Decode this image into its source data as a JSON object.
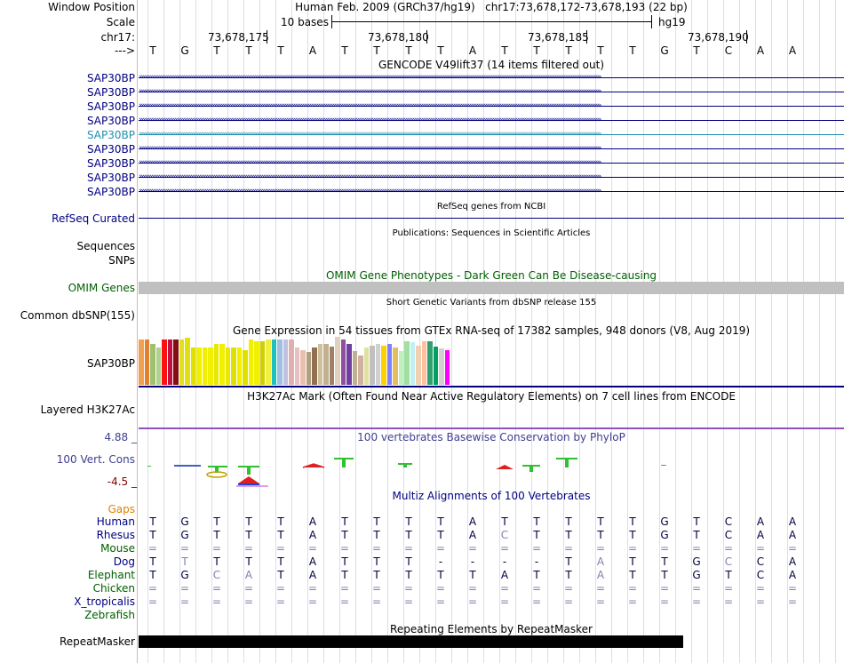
{
  "header": {
    "window_position_label": "Window Position",
    "scale_label": "Scale",
    "chrom_label": "chr17:",
    "strand_label": "--->",
    "window_position_value": "Human Feb. 2009 (GRCh37/hg19)   chr17:73,678,172-73,678,193 (22 bp)",
    "scale_bases": "10 bases",
    "scale_assembly": "hg19",
    "ticks": [
      "73,678,175",
      "73,678,180",
      "73,678,185",
      "73,678,190"
    ]
  },
  "sequence": [
    "T",
    "G",
    "T",
    "T",
    "T",
    "A",
    "T",
    "T",
    "T",
    "T",
    "A",
    "T",
    "T",
    "T",
    "T",
    "T",
    "G",
    "T",
    "C",
    "A",
    "A"
  ],
  "gencode": {
    "title": "GENCODE V49lift37 (14 items filtered out)",
    "items": [
      "SAP30BP",
      "SAP30BP",
      "SAP30BP",
      "SAP30BP",
      "SAP30BP",
      "SAP30BP",
      "SAP30BP",
      "SAP30BP",
      "SAP30BP"
    ]
  },
  "refseq": {
    "title": "RefSeq genes from NCBI",
    "label": "RefSeq Curated"
  },
  "publications": {
    "title": "Publications: Sequences in Scientific Articles",
    "label1": "Sequences",
    "label2": "SNPs"
  },
  "omim": {
    "title": "OMIM Gene Phenotypes - Dark Green Can Be Disease-causing",
    "label": "OMIM Genes"
  },
  "dbsnp": {
    "title": "Short Genetic Variants from dbSNP release 155",
    "label": "Common dbSNP(155)"
  },
  "gtex": {
    "title": "Gene Expression in 54 tissues from GTEx RNA-seq of 17382 samples, 948 donors (V8, Aug 2019)",
    "label": "SAP30BP",
    "levels": [
      0.95,
      0.95,
      0.85,
      0.78,
      0.95,
      0.95,
      0.95,
      0.95,
      0.98,
      0.78,
      0.78,
      0.78,
      0.78,
      0.85,
      0.85,
      0.78,
      0.78,
      0.78,
      0.72,
      0.95,
      0.9,
      0.9,
      0.95,
      0.95,
      0.95,
      0.95,
      0.95,
      0.78,
      0.72,
      0.68,
      0.78,
      0.85,
      0.85,
      0.8,
      1.0,
      0.95,
      0.85,
      0.7,
      0.62,
      0.78,
      0.82,
      0.85,
      0.82,
      0.85,
      0.78,
      0.7,
      0.9,
      0.88,
      0.82,
      0.9,
      0.9,
      0.8,
      0.75,
      0.72
    ],
    "colors": [
      "#f0a050",
      "#e08030",
      "#a0c070",
      "#b0d090",
      "#ff1010",
      "#c01040",
      "#801010",
      "#e0e020",
      "#e0e010",
      "#e0e000",
      "#f0f000",
      "#f0f000",
      "#f0f000",
      "#e8e800",
      "#f0f000",
      "#e8e800",
      "#e0e000",
      "#f0f000",
      "#e0e000",
      "#f0f000",
      "#f0f000",
      "#d0d000",
      "#f0f040",
      "#20c0c0",
      "#a0c0e0",
      "#c0c0e0",
      "#e0b0b0",
      "#e8c0c0",
      "#e8c0b0",
      "#b0a080",
      "#907050",
      "#d0c0a0",
      "#c0b090",
      "#a08060",
      "#e0d0c0",
      "#9050a0",
      "#7040a0",
      "#c0b090",
      "#d0b0a0",
      "#e0e0a0",
      "#c0c0c0",
      "#d0d0d0",
      "#ffd000",
      "#8080ff",
      "#e0c060",
      "#c0f0c0",
      "#a0e0a0",
      "#c0f0f0",
      "#f0d0b0",
      "#ffc0a0",
      "#30a070",
      "#00a060",
      "#d0d0d0",
      "#ff00ff"
    ]
  },
  "h3k27ac": {
    "title": "H3K27Ac Mark (Often Found Near Active Regulatory Elements) on 7 cell lines from ENCODE",
    "label": "Layered H3K27Ac"
  },
  "phylop": {
    "title": "100 vertebrates Basewise Conservation by PhyloP",
    "label": "100 Vert. Cons",
    "max": "4.88 _",
    "min": "-4.5 _"
  },
  "multiz": {
    "title": "Multiz Alignments of 100 Vertebrates",
    "gaps_label": "Gaps",
    "species": [
      {
        "name": "Human",
        "color": "#000080",
        "seq": [
          "T",
          "G",
          "T",
          "T",
          "T",
          "A",
          "T",
          "T",
          "T",
          "T",
          "A",
          "T",
          "T",
          "T",
          "T",
          "T",
          "G",
          "T",
          "C",
          "A",
          "A"
        ],
        "faint": []
      },
      {
        "name": "Rhesus",
        "color": "#000080",
        "seq": [
          "T",
          "G",
          "T",
          "T",
          "T",
          "A",
          "T",
          "T",
          "T",
          "T",
          "A",
          "C",
          "T",
          "T",
          "T",
          "T",
          "G",
          "T",
          "C",
          "A",
          "A"
        ],
        "faint": [
          11
        ]
      },
      {
        "name": "Mouse",
        "color": "#006000",
        "seq": [
          "=",
          "=",
          "=",
          "=",
          "=",
          "=",
          "=",
          "=",
          "=",
          "=",
          "=",
          "=",
          "=",
          "=",
          "=",
          "=",
          "=",
          "=",
          "=",
          "=",
          "="
        ],
        "faint": []
      },
      {
        "name": "Dog",
        "color": "#000080",
        "seq": [
          "T",
          "T",
          "T",
          "T",
          "T",
          "A",
          "T",
          "T",
          "T",
          "-",
          "-",
          "-",
          "-",
          "T",
          "A",
          "T",
          "T",
          "G",
          "C",
          "C",
          "A",
          "A"
        ],
        "faint": [
          1,
          14,
          18
        ]
      },
      {
        "name": "Elephant",
        "color": "#006000",
        "seq": [
          "T",
          "G",
          "C",
          "A",
          "T",
          "A",
          "T",
          "T",
          "T",
          "T",
          "T",
          "A",
          "T",
          "T",
          "A",
          "T",
          "T",
          "G",
          "T",
          "C",
          "A",
          "A"
        ],
        "faint": [
          2,
          3,
          14
        ]
      },
      {
        "name": "Chicken",
        "color": "#006000",
        "seq": [
          "=",
          "=",
          "=",
          "=",
          "=",
          "=",
          "=",
          "=",
          "=",
          "=",
          "=",
          "=",
          "=",
          "=",
          "=",
          "=",
          "=",
          "=",
          "=",
          "=",
          "="
        ],
        "faint": []
      },
      {
        "name": "X_tropicalis",
        "color": "#000080",
        "seq": [
          "=",
          "=",
          "=",
          "=",
          "=",
          "=",
          "=",
          "=",
          "=",
          "=",
          "=",
          "=",
          "=",
          "=",
          "=",
          "=",
          "=",
          "=",
          "=",
          "=",
          "="
        ],
        "faint": []
      },
      {
        "name": "Zebrafish",
        "color": "#006000",
        "seq": [],
        "faint": []
      }
    ]
  },
  "repeatmasker": {
    "title": "Repeating Elements by RepeatMasker",
    "label": "RepeatMasker"
  },
  "colors": {
    "track_navy": "#000080",
    "highlight": "#2090b0",
    "omim_green": "#006000",
    "omim_bar": "#c0c0c0",
    "gaps_orange": "#e08000",
    "phylop_label": "#404090",
    "phylop_min": "#800000"
  }
}
